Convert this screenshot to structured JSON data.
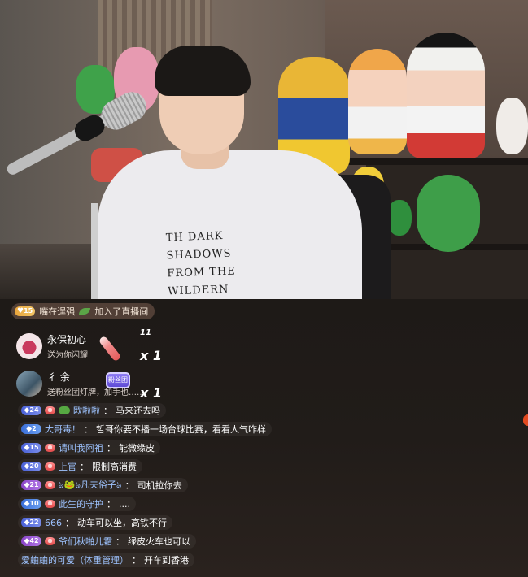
{
  "video": {
    "shirt_print_lines": [
      "TH DARK SHADOWS",
      "FROM THE WILDERN"
    ]
  },
  "join": {
    "level": "15",
    "user": "嘴在逞强",
    "text": "加入了直播间"
  },
  "gifts": [
    {
      "name": "永保初心",
      "action": "送为你闪耀",
      "combo": "x 1",
      "combo_top": "11"
    },
    {
      "name": "彳 余",
      "action": "送粉丝团灯牌，加手也……",
      "combo": "x 1",
      "badge": "粉丝团"
    }
  ],
  "messages": [
    {
      "level": "24",
      "level_style": "blue",
      "badge": "gem",
      "icon": "frog",
      "user": "欧啦啦",
      "text": "马来还去吗"
    },
    {
      "level": "2",
      "level_style": "sky",
      "badge": "shield",
      "icon": "",
      "user": "大哥毒！",
      "text": "哲哥你要不播一场台球比赛，看看人气咋样"
    },
    {
      "level": "15",
      "level_style": "blue",
      "badge": "gem",
      "icon": "",
      "user": "请叫我阿祖",
      "text": "能微缘皮"
    },
    {
      "level": "20",
      "level_style": "blue",
      "badge": "gem",
      "icon": "",
      "user": "上官",
      "text": "限制高消费"
    },
    {
      "level": "21",
      "level_style": "purple",
      "badge": "gem",
      "icon": "",
      "user": "ঌ🐸ঌ凡夫俗子ঌ",
      "text": "司机拉你去"
    },
    {
      "level": "10",
      "level_style": "sky",
      "badge": "gem",
      "icon": "",
      "user": "此生的守护",
      "text": "...."
    },
    {
      "level": "22",
      "level_style": "blue",
      "badge": "",
      "icon": "",
      "user": "666",
      "text": "动车可以坐，高铁不行"
    },
    {
      "level": "42",
      "level_style": "purple",
      "badge": "gem",
      "icon": "",
      "user": "爷们秋啪儿霜",
      "text": "绿皮火车也可以"
    },
    {
      "level": "",
      "level_style": "",
      "badge": "",
      "icon": "",
      "user": "爱蛐蛐的可爱（体重管理）",
      "text": "开车到香港"
    }
  ],
  "colors": {
    "username_blue": "#9ec3ff",
    "username_gold": "#ffd86b",
    "accent_orange": "#e34a20"
  }
}
